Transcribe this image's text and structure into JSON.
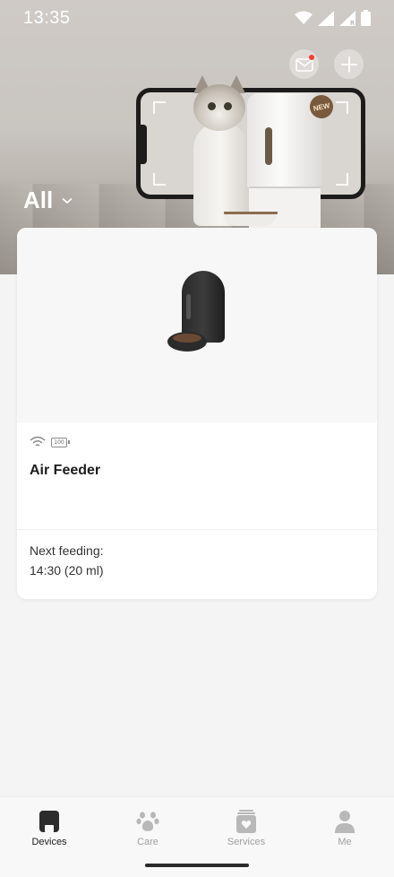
{
  "status_bar": {
    "time": "13:35"
  },
  "header": {
    "filter_label": "All",
    "promo_badge": "NEW"
  },
  "device_card": {
    "name": "Air Feeder",
    "battery_level": "100",
    "next_feeding_label": "Next feeding:",
    "next_feeding_value": "14:30 (20 ml)"
  },
  "bottom_nav": {
    "items": [
      {
        "label": "Devices",
        "icon": "devices-icon",
        "active": true
      },
      {
        "label": "Care",
        "icon": "paw-icon",
        "active": false
      },
      {
        "label": "Services",
        "icon": "services-icon",
        "active": false
      },
      {
        "label": "Me",
        "icon": "person-icon",
        "active": false
      }
    ]
  },
  "colors": {
    "background": "#f4f4f4",
    "card": "#ffffff",
    "notification_dot": "#ff3b30",
    "active_nav": "#1d1d1d",
    "inactive_nav": "#a0a0a0"
  }
}
